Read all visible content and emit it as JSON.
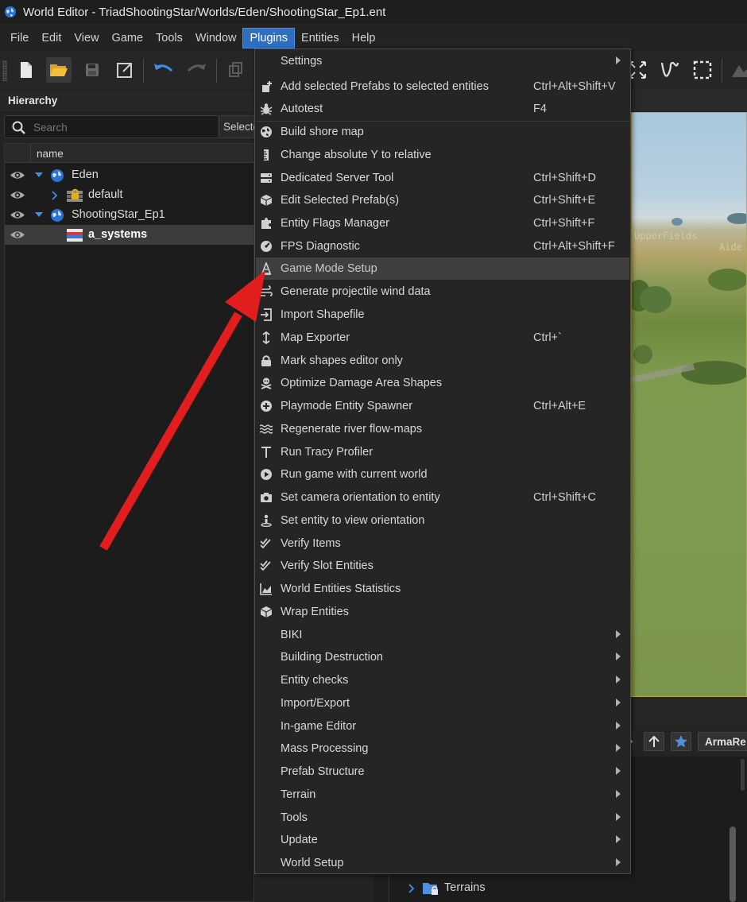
{
  "window": {
    "title": "World Editor - TriadShootingStar/Worlds/Eden/ShootingStar_Ep1.ent",
    "app_icon": "globe-icon"
  },
  "menubar": {
    "items": [
      {
        "label": "File"
      },
      {
        "label": "Edit"
      },
      {
        "label": "View"
      },
      {
        "label": "Game"
      },
      {
        "label": "Tools"
      },
      {
        "label": "Window"
      },
      {
        "label": "Plugins",
        "active": true
      },
      {
        "label": "Entities"
      },
      {
        "label": "Help"
      }
    ]
  },
  "toolbar": {
    "left_icons": [
      "new-file-icon",
      "open-folder-icon",
      "save-icon",
      "external-link-icon",
      "undo-icon",
      "redo-icon",
      "copy-icon"
    ],
    "right_icons": [
      "expand-icon",
      "curve-tool-icon",
      "selection-box-icon"
    ]
  },
  "hierarchy": {
    "title": "Hierarchy",
    "search": {
      "placeholder": "Search",
      "value": ""
    },
    "select_button": "Selecte",
    "column_name": "name",
    "rows": [
      {
        "label": "Eden",
        "icon": "globe-icon",
        "expanded": true,
        "level": 0
      },
      {
        "label": "default",
        "icon": "locked-layer-icon",
        "expanded": false,
        "level": 1
      },
      {
        "label": "ShootingStar_Ep1",
        "icon": "globe-icon",
        "expanded": true,
        "level": 0
      },
      {
        "label": "a_systems",
        "icon": "layer-stack-icon",
        "level": 1,
        "selected": true
      }
    ]
  },
  "viewport": {
    "labels": [
      "UpperFields",
      "Alde"
    ]
  },
  "browser": {
    "location_button": "ArmaRe",
    "folder_label": "Terrains"
  },
  "plugins_menu": {
    "items": [
      {
        "label": "Settings",
        "submenu": true,
        "icon": ""
      },
      {
        "label": "Add selected Prefabs to selected entities",
        "shortcut": "Ctrl+Alt+Shift+V",
        "icon": "add-prefab-icon"
      },
      {
        "label": "Autotest",
        "shortcut": "F4",
        "icon": "bug-icon"
      },
      {
        "label": "Build shore map",
        "shortcut": "",
        "icon": "globe-europe-icon"
      },
      {
        "label": "Change absolute Y to relative",
        "shortcut": "",
        "icon": "ruler-icon"
      },
      {
        "label": "Dedicated Server Tool",
        "shortcut": "Ctrl+Shift+D",
        "icon": "server-icon"
      },
      {
        "label": "Edit Selected Prefab(s)",
        "shortcut": "Ctrl+Shift+E",
        "icon": "cube-icon"
      },
      {
        "label": "Entity Flags Manager",
        "shortcut": "Ctrl+Shift+F",
        "icon": "puzzle-icon"
      },
      {
        "label": "FPS Diagnostic",
        "shortcut": "Ctrl+Alt+Shift+F",
        "icon": "gauge-icon"
      },
      {
        "label": "Game Mode Setup",
        "shortcut": "",
        "icon": "wizard-icon",
        "highlighted": true
      },
      {
        "label": "Generate projectile wind data",
        "shortcut": "",
        "icon": "wind-icon"
      },
      {
        "label": "Import Shapefile",
        "shortcut": "",
        "icon": "import-icon"
      },
      {
        "label": "Map Exporter",
        "shortcut": "Ctrl+`",
        "icon": "vertical-arrows-icon"
      },
      {
        "label": "Mark shapes editor only",
        "shortcut": "",
        "icon": "lock-icon"
      },
      {
        "label": "Optimize Damage Area Shapes",
        "shortcut": "",
        "icon": "skull-crossbones-icon"
      },
      {
        "label": "Playmode Entity Spawner",
        "shortcut": "Ctrl+Alt+E",
        "icon": "plus-circle-icon"
      },
      {
        "label": "Regenerate river flow-maps",
        "shortcut": "",
        "icon": "water-icon"
      },
      {
        "label": "Run Tracy Profiler",
        "shortcut": "",
        "icon": "text-t-icon"
      },
      {
        "label": "Run game with current world",
        "shortcut": "",
        "icon": "play-circle-icon"
      },
      {
        "label": "Set camera orientation to entity",
        "shortcut": "Ctrl+Shift+C",
        "icon": "camera-icon"
      },
      {
        "label": "Set entity to view orientation",
        "shortcut": "",
        "icon": "person-pin-icon"
      },
      {
        "label": "Verify Items",
        "shortcut": "",
        "icon": "double-check-icon"
      },
      {
        "label": "Verify Slot Entities",
        "shortcut": "",
        "icon": "double-check-icon"
      },
      {
        "label": "World Entities Statistics",
        "shortcut": "",
        "icon": "chart-area-icon"
      },
      {
        "label": "Wrap Entities",
        "shortcut": "",
        "icon": "box-icon"
      },
      {
        "label": "BIKI",
        "submenu": true,
        "icon": ""
      },
      {
        "label": "Building Destruction",
        "submenu": true,
        "icon": ""
      },
      {
        "label": "Entity checks",
        "submenu": true,
        "icon": ""
      },
      {
        "label": "Import/Export",
        "submenu": true,
        "icon": ""
      },
      {
        "label": "In-game Editor",
        "submenu": true,
        "icon": ""
      },
      {
        "label": "Mass Processing",
        "submenu": true,
        "icon": ""
      },
      {
        "label": "Prefab Structure",
        "submenu": true,
        "icon": ""
      },
      {
        "label": "Terrain",
        "submenu": true,
        "icon": ""
      },
      {
        "label": "Tools",
        "submenu": true,
        "icon": ""
      },
      {
        "label": "Update",
        "submenu": true,
        "icon": ""
      },
      {
        "label": "World Setup",
        "submenu": true,
        "icon": ""
      }
    ]
  },
  "annotation": {
    "type": "red-arrow",
    "color": "#e21d1d",
    "points_to": "Game Mode Setup"
  },
  "colors": {
    "accent": "#2f6fc0",
    "globe": "#3b8fe6",
    "arrow": "#e21d1d",
    "viewport_border": "#b8a93c"
  }
}
